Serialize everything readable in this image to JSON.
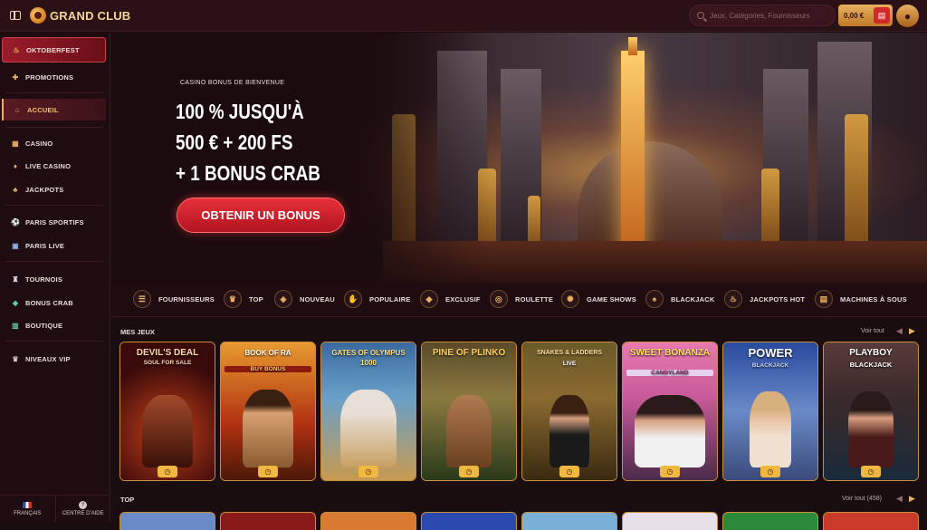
{
  "header": {
    "brand": "GRAND CLUB",
    "search_placeholder": "Jeux, Catégories, Fournisseurs",
    "balance": "0,00 €"
  },
  "sidebar": {
    "items": [
      {
        "label": "OKTOBERFEST",
        "icon": "beer-icon"
      },
      {
        "label": "PROMOTIONS",
        "icon": "gift-icon"
      },
      {
        "label": "ACCUEIL",
        "icon": "home-icon"
      },
      {
        "label": "CASINO",
        "icon": "casino-icon"
      },
      {
        "label": "LIVE CASINO",
        "icon": "bell-icon"
      },
      {
        "label": "JACKPOTS",
        "icon": "clover-icon"
      },
      {
        "label": "PARIS SPORTIFS",
        "icon": "soccer-ball-icon"
      },
      {
        "label": "PARIS LIVE",
        "icon": "live-icon"
      },
      {
        "label": "TOURNOIS",
        "icon": "trophy-icon"
      },
      {
        "label": "BONUS CRAB",
        "icon": "crab-icon"
      },
      {
        "label": "BOUTIQUE",
        "icon": "shop-icon"
      },
      {
        "label": "NIVEAUX VIP",
        "icon": "crown-icon"
      }
    ],
    "language": "FRANÇAIS",
    "help": "CENTRE D'AIDE"
  },
  "hero": {
    "kicker": "CASINO BONUS DE BIENVENUE",
    "line1": "100 % JUSQU'À",
    "line2": "500 € + 200 FS",
    "line3": "+ 1 BONUS CRAB",
    "cta": "OBTENIR UN BONUS"
  },
  "categories": [
    {
      "label": "FOURNISSEURS",
      "icon": "providers-icon"
    },
    {
      "label": "TOP",
      "icon": "crown-icon"
    },
    {
      "label": "NOUVEAU",
      "icon": "tag-icon"
    },
    {
      "label": "POPULAIRE",
      "icon": "thumbs-up-icon"
    },
    {
      "label": "EXCLUSIF",
      "icon": "diamond-icon"
    },
    {
      "label": "ROULETTE",
      "icon": "roulette-icon"
    },
    {
      "label": "GAME SHOWS",
      "icon": "wheel-icon"
    },
    {
      "label": "BLACKJACK",
      "icon": "cards-icon"
    },
    {
      "label": "JACKPOTS HOT",
      "icon": "flame-icon"
    },
    {
      "label": "MACHINES À SOUS",
      "icon": "slot-icon"
    }
  ],
  "mes_jeux": {
    "title": "MES JEUX",
    "see_all": "Voir tout",
    "games": [
      {
        "title": "DEVIL'S DEAL",
        "sub": "SOUL FOR SALE"
      },
      {
        "title": "BOOK OF RA",
        "sub": "BUY BONUS"
      },
      {
        "title": "GATES OF OLYMPUS 1000",
        "sub": ""
      },
      {
        "title": "PINE OF PLINKO",
        "sub": ""
      },
      {
        "title": "SNAKES & LADDERS",
        "sub": "LIVE"
      },
      {
        "title": "SWEET BONANZA",
        "sub": "CANDYLAND"
      },
      {
        "title": "POWER",
        "sub": "BLACKJACK"
      },
      {
        "title": "PLAYBOY",
        "sub": "BLACKJACK"
      }
    ]
  },
  "top": {
    "title": "TOP",
    "see_all": "Voir tout (458)"
  },
  "colors": {
    "accent": "#e8b060",
    "cta": "#d0202c",
    "background": "#1a0d10"
  }
}
